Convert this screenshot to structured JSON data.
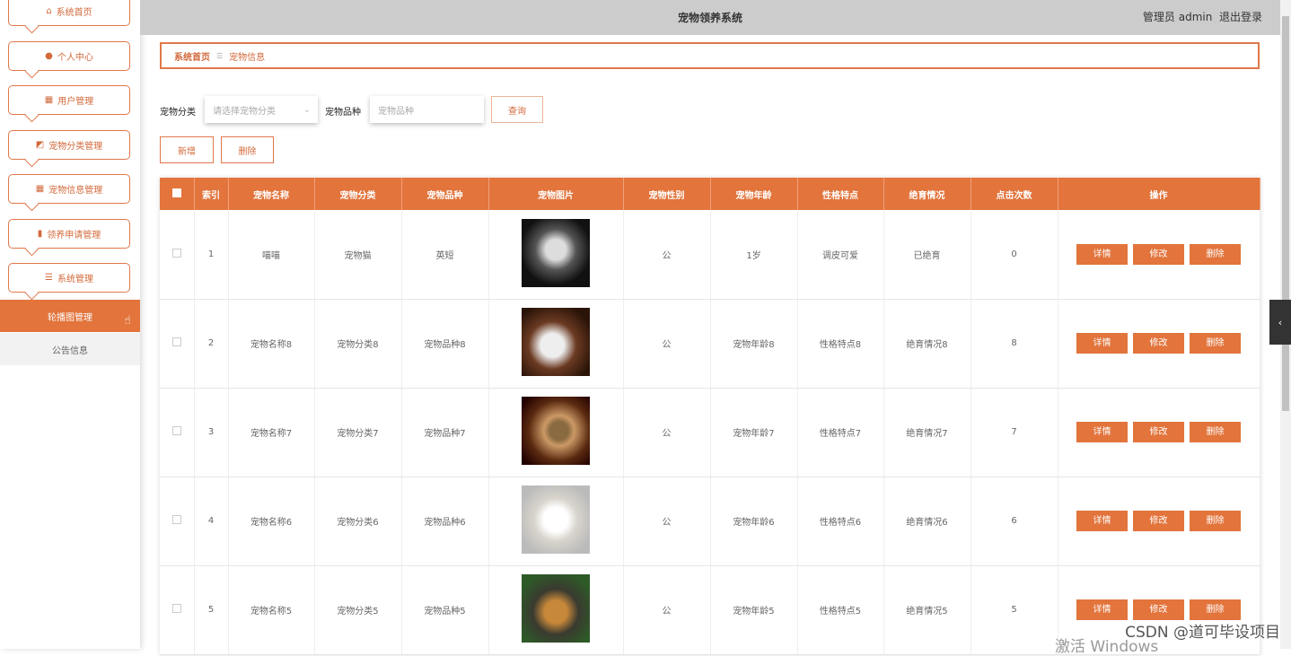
{
  "sidebar": {
    "items": [
      {
        "label": "系统首页",
        "icon": "home-icon",
        "glyph": "⌂"
      },
      {
        "label": "个人中心",
        "icon": "user-icon",
        "glyph": "●"
      },
      {
        "label": "用户管理",
        "icon": "grid-icon",
        "glyph": "▦"
      },
      {
        "label": "宠物分类管理",
        "icon": "chart-icon",
        "glyph": "◩"
      },
      {
        "label": "宠物信息管理",
        "icon": "grid-icon",
        "glyph": "▦"
      },
      {
        "label": "领养申请管理",
        "icon": "bar-chart-icon",
        "glyph": "▮"
      },
      {
        "label": "系统管理",
        "icon": "list-icon",
        "glyph": "☰"
      }
    ],
    "sub": [
      {
        "label": "轮播图管理"
      },
      {
        "label": "公告信息"
      }
    ]
  },
  "header": {
    "title": "宠物领养系统",
    "user": "管理员 admin",
    "logout": "退出登录"
  },
  "breadcrumb": {
    "home": "系统首页",
    "sep": "☰",
    "current": "宠物信息"
  },
  "search": {
    "category_label": "宠物分类",
    "category_placeholder": "请选择宠物分类",
    "breed_label": "宠物品种",
    "breed_placeholder": "宠物品种",
    "query": "查询",
    "add": "新增",
    "delete": "删除"
  },
  "table": {
    "headers": [
      "索引",
      "宠物名称",
      "宠物分类",
      "宠物品种",
      "宠物图片",
      "宠物性别",
      "宠物年龄",
      "性格特点",
      "绝育情况",
      "点击次数",
      "操作"
    ],
    "actions": {
      "detail": "详情",
      "edit": "修改",
      "delete": "删除"
    },
    "rows": [
      [
        "1",
        "喵喵",
        "宠物猫",
        "英短",
        "公",
        "1岁",
        "调皮可爱",
        "已绝育",
        "0"
      ],
      [
        "2",
        "宠物名称8",
        "宠物分类8",
        "宠物品种8",
        "公",
        "宠物年龄8",
        "性格特点8",
        "绝育情况8",
        "8"
      ],
      [
        "3",
        "宠物名称7",
        "宠物分类7",
        "宠物品种7",
        "公",
        "宠物年龄7",
        "性格特点7",
        "绝育情况7",
        "7"
      ],
      [
        "4",
        "宠物名称6",
        "宠物分类6",
        "宠物品种6",
        "公",
        "宠物年龄6",
        "性格特点6",
        "绝育情况6",
        "6"
      ],
      [
        "5",
        "宠物名称5",
        "宠物分类5",
        "宠物品种5",
        "公",
        "宠物年龄5",
        "性格特点5",
        "绝育情况5",
        "5"
      ]
    ]
  },
  "watermark": "CSDN @道可毕设项目",
  "windows": "激活 Windows",
  "colors": {
    "accent": "#e2743c"
  }
}
